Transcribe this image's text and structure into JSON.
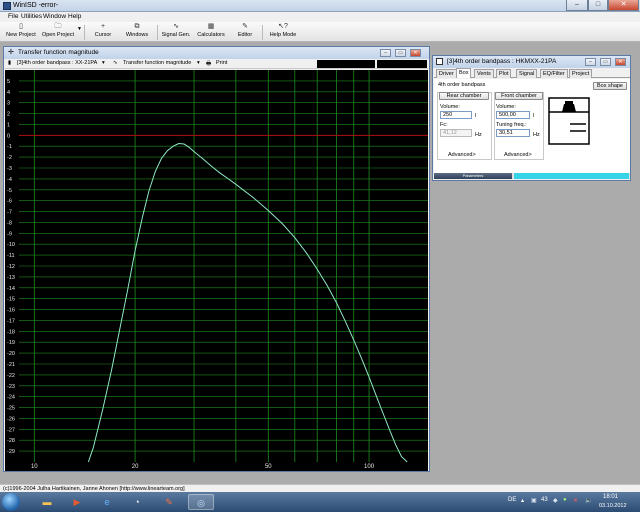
{
  "app": {
    "title": "WinISD -error-"
  },
  "menu": [
    "File",
    "Utilities",
    "Window",
    "Help"
  ],
  "toolbar": {
    "new_project": "New Project",
    "open_project": "Open Project",
    "cursor": "Cursor",
    "windows": "Windows",
    "signal_gen": "Signal Gen.",
    "calculators": "Calculators",
    "editor": "Editor",
    "help_mode": "Help Mode"
  },
  "tf_window": {
    "title": "Transfer function magnitude",
    "project_select": "[3]4th order bandpass : XX-21PA",
    "view_select": "Transfer function magnitude",
    "print_label": "Print"
  },
  "chart_data": {
    "type": "line",
    "title": "",
    "xlabel": "",
    "ylabel": "",
    "x_scale": "log",
    "xlim": [
      9,
      150
    ],
    "ylim": [
      -30,
      6
    ],
    "x_ticks": [
      10,
      20,
      50,
      100
    ],
    "x_tick_labels": [
      "10",
      "20",
      "50",
      "100"
    ],
    "y_ticks": [
      5,
      4,
      3,
      2,
      1,
      0,
      -1,
      -2,
      -3,
      -4,
      -5,
      -6,
      -7,
      -8,
      -9,
      -10,
      -11,
      -12,
      -13,
      -14,
      -15,
      -16,
      -17,
      -18,
      -19,
      -20,
      -21,
      -22,
      -23,
      -24,
      -25,
      -26,
      -27,
      -28,
      -29
    ],
    "y_tick_labels": [
      "5",
      "4",
      "3",
      "2",
      "1",
      "0",
      "-1",
      "-2",
      "-3",
      "-4",
      "-5",
      "-6",
      "-7",
      "-8",
      "-9",
      "-10",
      "-11",
      "-12",
      "-13",
      "-14",
      "-15",
      "-16",
      "-17",
      "-18",
      "-19",
      "-20",
      "-21",
      "-22",
      "-23",
      "-24",
      "-25",
      "-26",
      "-27",
      "-28",
      "-29"
    ],
    "reference_line_y": 0,
    "grid": true,
    "colors": {
      "background": "#000000",
      "grid": "#1e8c1e",
      "reference": "#b01010",
      "curve": "#8fe6c8",
      "tick_text": "#e8e8e8"
    },
    "series": [
      {
        "x": [
          14.5,
          15,
          16,
          17,
          18,
          19,
          20,
          21,
          22,
          23,
          24,
          25,
          26,
          27,
          28,
          29,
          30,
          32,
          34,
          36,
          38,
          40,
          45,
          50,
          55,
          60,
          65,
          70,
          75,
          80,
          85,
          90,
          95,
          100,
          105,
          110,
          115,
          120,
          125,
          130
        ],
        "y": [
          -30,
          -28.7,
          -25.2,
          -21.6,
          -17.8,
          -14.2,
          -10.6,
          -7.6,
          -5.1,
          -3.3,
          -2.1,
          -1.4,
          -1.0,
          -0.75,
          -0.8,
          -1.1,
          -1.5,
          -2.2,
          -2.9,
          -3.5,
          -4.0,
          -4.5,
          -5.7,
          -6.9,
          -8.1,
          -9.4,
          -10.8,
          -12.3,
          -13.8,
          -15.4,
          -17.1,
          -18.8,
          -20.5,
          -22.2,
          -23.9,
          -25.5,
          -27.0,
          -28.4,
          -29.5,
          -30
        ]
      }
    ]
  },
  "box_window": {
    "title": "[3]4th order bandpass : HKMXX-21PA",
    "tabs": [
      "Driver",
      "Box",
      "Vents",
      "Plot",
      "Signal",
      "EQ/Filter",
      "Project"
    ],
    "active_tab": "Box",
    "design_type": "4th order bandpass",
    "box_shape_label": "Box shape",
    "rear": {
      "header": "Rear chamber",
      "volume_label": "Volume:",
      "volume_value": "250",
      "volume_unit": "l",
      "fc_label": "Fc:",
      "fc_value": "41,12",
      "fc_unit": "Hz",
      "advanced": "Advanced>"
    },
    "front": {
      "header": "Front chamber",
      "volume_label": "Volume:",
      "volume_value": "500,00",
      "volume_unit": "l",
      "tuning_label": "Tuning freq.:",
      "tuning_value": "30,51",
      "tuning_unit": "Hz",
      "advanced": "Advanced>"
    },
    "status_label": "Parameters"
  },
  "statusbar": {
    "text": "(c)1996-2004 Julha Hartikainen, Janne Ahonen [http://www.linearteam.org]"
  },
  "taskbar": {
    "language": "DE",
    "clock_time": "18:01",
    "clock_date": "03.10.2012",
    "tray_number": "43"
  }
}
